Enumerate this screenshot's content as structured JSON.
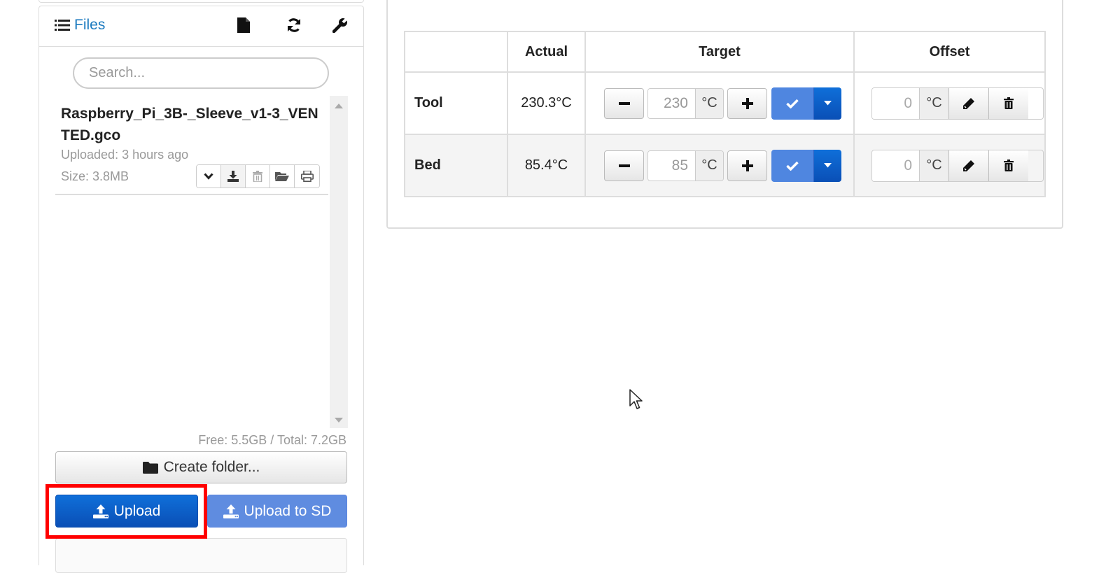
{
  "files_panel": {
    "title": "Files",
    "icons": [
      "list-icon",
      "new-file-icon",
      "refresh-icon",
      "wrench-icon"
    ],
    "search": {
      "placeholder": "Search...",
      "value": ""
    },
    "files": [
      {
        "name": "Raspberry_Pi_3B-_Sleeve_v1-3_VENTED.gco",
        "uploaded": "Uploaded: 3 hours ago",
        "size": "Size: 3.8MB",
        "actions": [
          "chevron-down-icon",
          "download-icon",
          "trash-icon",
          "folder-open-icon",
          "print-icon"
        ]
      }
    ],
    "storage": "Free: 5.5GB / Total: 7.2GB",
    "create_folder_label": "Create folder...",
    "upload_label": "Upload",
    "upload_sd_label": "Upload to SD"
  },
  "temperature": {
    "headers": [
      "",
      "Actual",
      "Target",
      "Offset"
    ],
    "unit": "°C",
    "rows": [
      {
        "label": "Tool",
        "actual": "230.3°C",
        "target": "230",
        "offset": "0"
      },
      {
        "label": "Bed",
        "actual": "85.4°C",
        "target": "85",
        "offset": "0"
      }
    ]
  },
  "colors": {
    "link": "#1b7abf",
    "primary": "#0a4fb6",
    "primary_light": "#5f8ce0",
    "highlight": "#ff0000"
  }
}
